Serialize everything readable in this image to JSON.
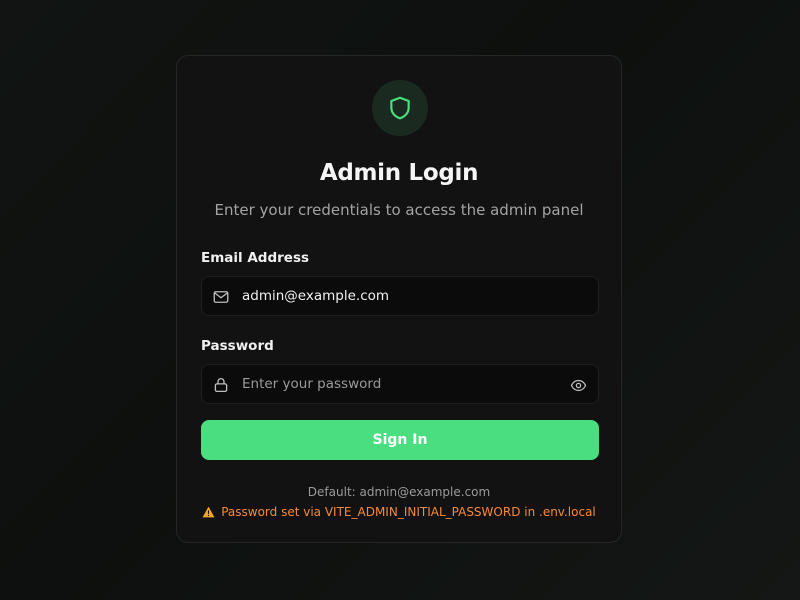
{
  "login_card": {
    "logo_icon": "shield-icon",
    "title": "Admin Login",
    "subtitle": "Enter your credentials to access the admin panel",
    "email": {
      "label": "Email Address",
      "value": "admin@example.com",
      "placeholder": "",
      "icon": "mail-icon"
    },
    "password": {
      "label": "Password",
      "value": "",
      "placeholder": "Enter your password",
      "icon": "lock-icon",
      "toggle_icon": "eye-icon"
    },
    "signin_label": "Sign In",
    "default_hint": "Default: admin@example.com",
    "warning_icon": "warning-icon",
    "warning_text": "Password set via VITE_ADMIN_INITIAL_PASSWORD in .env.local"
  },
  "colors": {
    "accent": "#4ade80",
    "background": "#0f1211",
    "card": "#121212",
    "warning": "#f58a3c"
  }
}
